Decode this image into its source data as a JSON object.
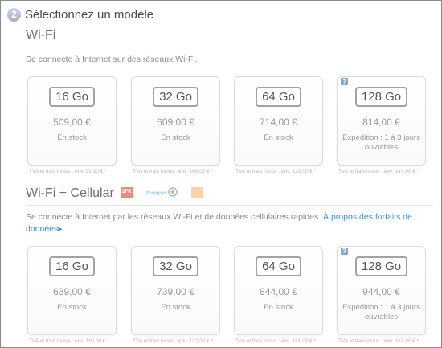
{
  "step": {
    "number": "2",
    "title": "Sélectionnez un modèle"
  },
  "wifi": {
    "title": "Wi-Fi",
    "description": "Se connecte à Internet sur des réseaux Wi-Fi.",
    "models": [
      {
        "capacity": "16 Go",
        "price": "509,00 €",
        "availability": "En stock",
        "tax": "TVA et frais inclus : env. 32,00 € *"
      },
      {
        "capacity": "32 Go",
        "price": "609,00 €",
        "availability": "En stock",
        "tax": "TVA et frais inclus : env. 100,00 € *"
      },
      {
        "capacity": "64 Go",
        "price": "714,00 €",
        "availability": "En stock",
        "tax": "TVA et frais inclus : env. 120,00 € *"
      },
      {
        "capacity": "128 Go",
        "price": "814,00 €",
        "availability": "Expédition : 1 à 3 jours ouvrables",
        "tax": "TVA et frais inclus : env. 140,00 € *"
      }
    ]
  },
  "cellular": {
    "title": "Wi-Fi + Cellular",
    "carriers": [
      "SFR",
      "Bouygues Telecom",
      "Orange"
    ],
    "description": "Se connecte à Internet par les réseaux Wi-Fi et de données cellulaires rapides.",
    "link_text": "À propos des forfaits de données",
    "link_arrow": "▸",
    "models": [
      {
        "capacity": "16 Go",
        "price": "639,00 €",
        "availability": "En stock",
        "tax": "TVA et frais inclus : env. 110,00 € *"
      },
      {
        "capacity": "32 Go",
        "price": "739,00 €",
        "availability": "En stock",
        "tax": "TVA et frais inclus : env. 132,00 € *"
      },
      {
        "capacity": "64 Go",
        "price": "844,00 €",
        "availability": "En stock",
        "tax": "TVA et frais inclus : env. 151,00 € *"
      },
      {
        "capacity": "128 Go",
        "price": "944,00 €",
        "availability": "Expédition : 1 à 3 jours ouvrables",
        "tax": "TVA et frais inclus : env. 167,00 € *"
      }
    ]
  },
  "help_icon_glyph": "?",
  "colors": {
    "link": "#3a8fd0",
    "card_border": "#dcdcdc",
    "step_badge": "#9fb0c6"
  }
}
